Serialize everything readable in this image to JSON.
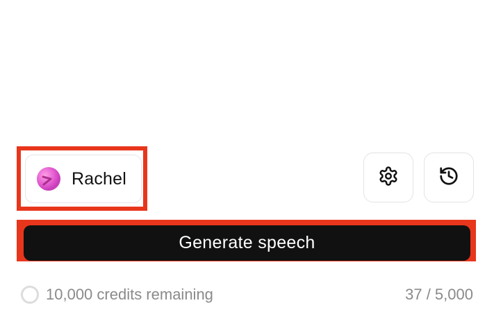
{
  "voice_selector": {
    "name": "Rachel",
    "avatar_icon": "gradient-orb-avatar",
    "highlight_color": "#e8361c"
  },
  "toolbar": {
    "settings_icon": "gear-icon",
    "history_icon": "history-icon"
  },
  "generate": {
    "label": "Generate speech",
    "background": "#111111",
    "highlight_color": "#e8361c"
  },
  "footer": {
    "credits_text": "10,000 credits remaining",
    "char_count": "37 / 5,000"
  }
}
